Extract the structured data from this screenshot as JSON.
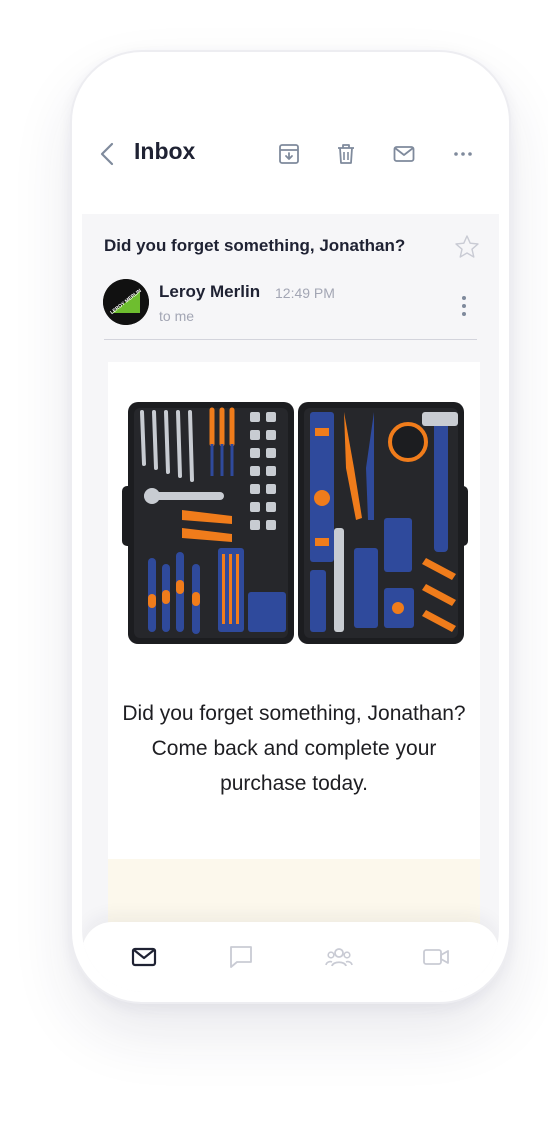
{
  "header": {
    "title": "Inbox"
  },
  "message": {
    "subject": "Did you forget something, Jonathan?",
    "sender": "Leroy Merlin",
    "time": "12:49 PM",
    "recipient": "to me",
    "avatar_text": "LEROY MERLIN"
  },
  "email_body": {
    "text": "Did you forget something, Jonathan? Come back and complete your purchase today."
  },
  "colors": {
    "text_dark": "#1f2233",
    "muted": "#a3a6b4",
    "brand_green": "#6ebe2f",
    "tool_orange": "#f07c1b",
    "tool_blue": "#2f4a9c",
    "case_black": "#1c1d20"
  },
  "icons": {
    "back": "chevron-left-icon",
    "archive": "archive-download-icon",
    "delete": "trash-icon",
    "mark": "envelope-icon",
    "more": "more-horizontal-icon",
    "star": "star-outline-icon",
    "nav": [
      "mail-icon",
      "chat-icon",
      "contacts-icon",
      "video-icon"
    ]
  }
}
